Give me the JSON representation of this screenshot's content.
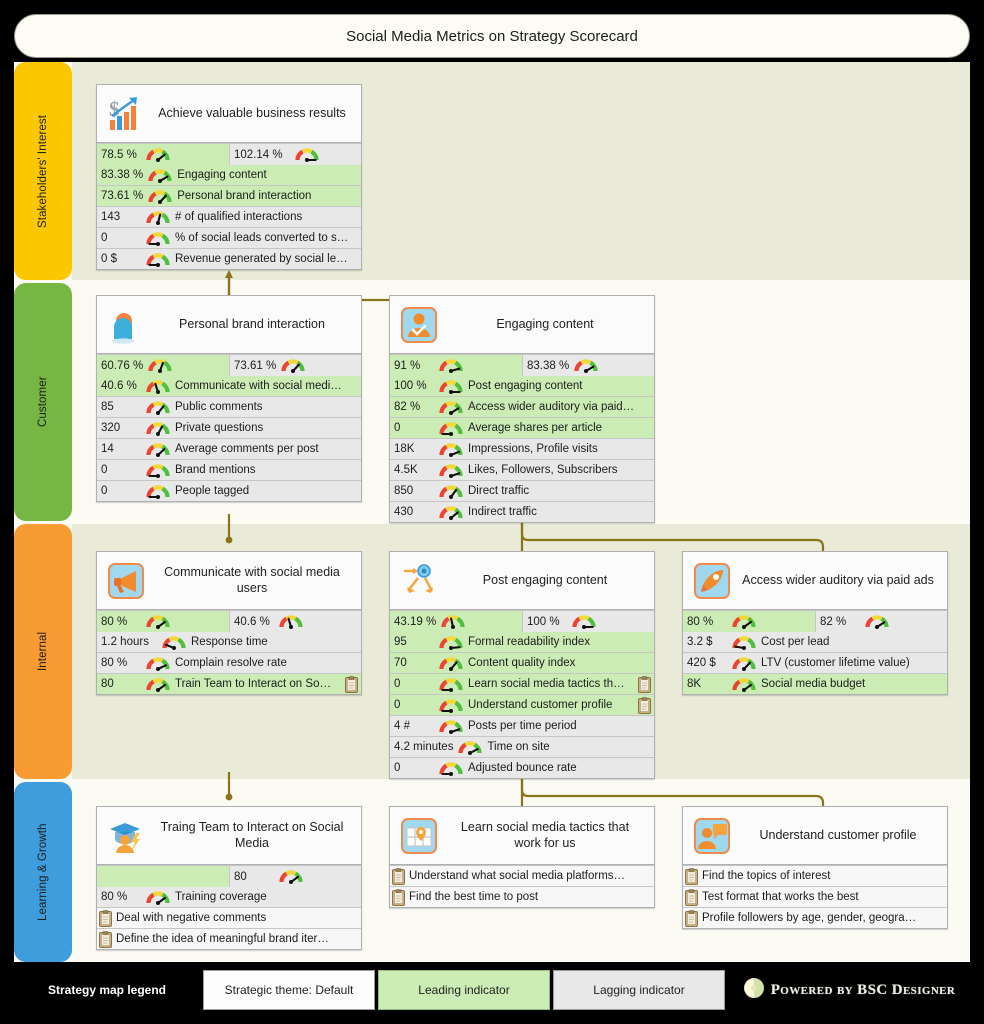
{
  "header": {
    "title": "Social Media Metrics on Strategy Scorecard"
  },
  "colors": {
    "band_stakeholders": "#fbc800",
    "band_customer": "#76b743",
    "band_internal": "#f99b33",
    "band_learning": "#3f9ddd",
    "leading_bg": "#ccecb6",
    "lagging_bg": "#e8e8e8",
    "connector": "#8a7418",
    "canvas": "#fbfbf4",
    "band_tint": "#eaead8"
  },
  "bands": [
    {
      "id": "stakeholders",
      "label": "Stakeholders' Interest",
      "color": "#fbc800"
    },
    {
      "id": "customer",
      "label": "Customer",
      "color": "#76b743"
    },
    {
      "id": "internal",
      "label": "Internal",
      "color": "#f99b33"
    },
    {
      "id": "learning",
      "label": "Learning & Growth",
      "color": "#3f9ddd"
    }
  ],
  "cards": {
    "achieve": {
      "title": "Achieve valuable business results",
      "icon": "dollar-growth-icon",
      "kpi_pair": [
        {
          "value": "78.5 %",
          "type": "leading",
          "gauge": 78.5
        },
        {
          "value": "102.14 %",
          "type": "lagging",
          "gauge": 102.14
        }
      ],
      "rows": [
        {
          "value": "83.38 %",
          "label": "Engaging content",
          "type": "leading",
          "gauge": 83
        },
        {
          "value": "73.61 %",
          "label": "Personal brand interaction",
          "type": "leading",
          "gauge": 74
        },
        {
          "value": "143",
          "label": "# of qualified interactions",
          "type": "lagging",
          "gauge": 60
        },
        {
          "value": "0",
          "label": "% of social leads converted to s…",
          "type": "lagging",
          "gauge": 0
        },
        {
          "value": "0 $",
          "label": "Revenue generated by social le…",
          "type": "lagging",
          "gauge": 0
        }
      ]
    },
    "personal_brand": {
      "title": "Personal brand interaction",
      "icon": "two-heads-icon",
      "kpi_pair": [
        {
          "value": "60.76 %",
          "type": "leading",
          "gauge": 60.76
        },
        {
          "value": "73.61 %",
          "type": "lagging",
          "gauge": 73.61
        }
      ],
      "rows": [
        {
          "value": "40.6 %",
          "label": "Communicate with social medi…",
          "type": "leading",
          "gauge": 40
        },
        {
          "value": "85",
          "label": "Public comments",
          "type": "lagging",
          "gauge": 75
        },
        {
          "value": "320",
          "label": "Private questions",
          "type": "lagging",
          "gauge": 72
        },
        {
          "value": "14",
          "label": "Average comments per post",
          "type": "lagging",
          "gauge": 78
        },
        {
          "value": "0",
          "label": "Brand mentions",
          "type": "lagging",
          "gauge": 0
        },
        {
          "value": "0",
          "label": "People tagged",
          "type": "lagging",
          "gauge": 0
        }
      ]
    },
    "engaging": {
      "title": "Engaging content",
      "icon": "user-check-icon",
      "kpi_pair": [
        {
          "value": "91 %",
          "type": "leading",
          "gauge": 91
        },
        {
          "value": "83.38 %",
          "type": "lagging",
          "gauge": 83.38
        }
      ],
      "rows": [
        {
          "value": "100 %",
          "label": "Post engaging content",
          "type": "leading",
          "gauge": 100
        },
        {
          "value": "82 %",
          "label": "Access wider auditory via paid…",
          "type": "leading",
          "gauge": 82
        },
        {
          "value": "0",
          "label": "Average shares per article",
          "type": "leading",
          "gauge": 0
        },
        {
          "value": "18K",
          "label": "Impressions, Profile visits",
          "type": "lagging",
          "gauge": 88
        },
        {
          "value": "4.5K",
          "label": "Likes, Followers, Subscribers",
          "type": "lagging",
          "gauge": 90
        },
        {
          "value": "850",
          "label": "Direct traffic",
          "type": "lagging",
          "gauge": 70
        },
        {
          "value": "430",
          "label": "Indirect traffic",
          "type": "lagging",
          "gauge": 80
        }
      ]
    },
    "communicate": {
      "title": "Communicate with social media users",
      "icon": "megaphone-icon",
      "kpi_pair": [
        {
          "value": "80 %",
          "type": "leading",
          "gauge": 80
        },
        {
          "value": "40.6 %",
          "type": "lagging",
          "gauge": 40.6
        }
      ],
      "rows": [
        {
          "value": "1.2 hours",
          "label": "Response time",
          "type": "lagging",
          "gauge": 15
        },
        {
          "value": "80 %",
          "label": "Complain resolve rate",
          "type": "lagging",
          "gauge": 85
        },
        {
          "value": "80",
          "label": "Train Team to Interact on So…",
          "type": "leading",
          "gauge": 80,
          "initiative": true
        }
      ]
    },
    "post_engaging": {
      "title": "Post engaging content",
      "icon": "target-arrows-icon",
      "kpi_pair": [
        {
          "value": "43.19 %",
          "type": "leading",
          "gauge": 43.19
        },
        {
          "value": "100 %",
          "type": "lagging",
          "gauge": 100
        }
      ],
      "rows": [
        {
          "value": "95",
          "label": "Formal readability index",
          "type": "leading",
          "gauge": 95
        },
        {
          "value": "70",
          "label": "Content quality index",
          "type": "leading",
          "gauge": 70
        },
        {
          "value": "0",
          "label": "Learn social media tactics th…",
          "type": "leading",
          "gauge": 0,
          "initiative": true
        },
        {
          "value": "0",
          "label": "Understand customer profile",
          "type": "leading",
          "gauge": 0,
          "initiative": true
        },
        {
          "value": "4 #",
          "label": "Posts per time period",
          "type": "lagging",
          "gauge": 88
        },
        {
          "value": "4.2 minutes",
          "label": "Time on site",
          "type": "lagging",
          "gauge": 85
        },
        {
          "value": "0",
          "label": "Adjusted bounce rate",
          "type": "lagging",
          "gauge": 0
        }
      ]
    },
    "paid_ads": {
      "title": "Access wider auditory via paid ads",
      "icon": "rocket-icon",
      "kpi_pair": [
        {
          "value": "80 %",
          "type": "leading",
          "gauge": 80
        },
        {
          "value": "82 %",
          "type": "lagging",
          "gauge": 82
        }
      ],
      "rows": [
        {
          "value": "3.2 $",
          "label": "Cost per lead",
          "type": "lagging",
          "gauge": 8
        },
        {
          "value": "420 $",
          "label": "LTV (customer lifetime value)",
          "type": "lagging",
          "gauge": 76
        },
        {
          "value": "8K",
          "label": "Social media budget",
          "type": "leading",
          "gauge": 80
        }
      ]
    },
    "train_team": {
      "title": "Traing Team to Interact on Social Media",
      "icon": "graduate-icon",
      "kpi_pair": [
        {
          "value": "",
          "type": "leading",
          "gauge": null
        },
        {
          "value": "80",
          "type": "lagging",
          "gauge": 80
        }
      ],
      "rows": [
        {
          "value": "80 %",
          "label": "Training coverage",
          "type": "lagging",
          "gauge": 80
        }
      ],
      "initiatives": [
        "Deal with negative comments",
        "Define the idea of meaningful brand iter…"
      ]
    },
    "learn_tactics": {
      "title": "Learn social media tactics that work for us",
      "icon": "map-pin-icon",
      "kpi_pair": [],
      "rows": [],
      "initiatives": [
        "Understand what social media platforms…",
        "Find the best time to post"
      ]
    },
    "understand_profile": {
      "title": "Understand customer profile",
      "icon": "person-chat-icon",
      "kpi_pair": [],
      "rows": [],
      "initiatives": [
        "Find the topics of interest",
        "Test format that works the best",
        "Profile followers by age, gender, geogra…"
      ]
    }
  },
  "legend": {
    "title": "Strategy map legend",
    "theme": "Strategic theme: Default",
    "leading": "Leading indicator",
    "lagging": "Lagging indicator",
    "brand": "Powered by BSC Designer"
  }
}
